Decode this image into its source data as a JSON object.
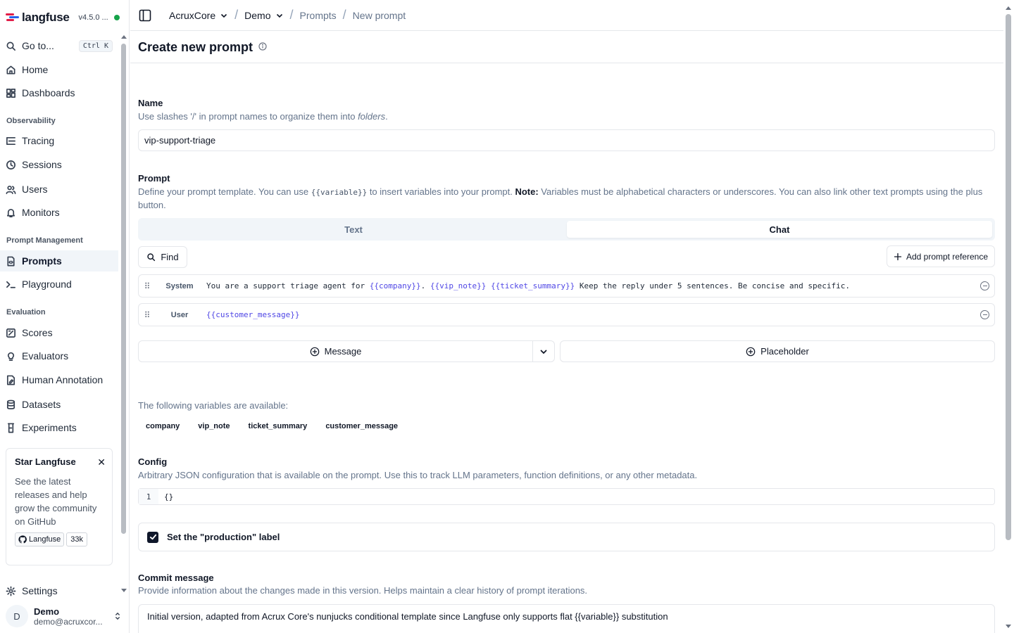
{
  "app": {
    "brand_name": "langfuse",
    "version": "v4.5.0 ...",
    "colors": {
      "accent": "#0f172a",
      "status_ok": "#16a34a",
      "variable": "#4f46e5",
      "muted": "#64748b"
    }
  },
  "sidebar": {
    "goto": {
      "label": "Go to...",
      "shortcut": "Ctrl K"
    },
    "top_items": [
      {
        "label": "Home",
        "icon": "home-icon"
      },
      {
        "label": "Dashboards",
        "icon": "dashboard-icon"
      }
    ],
    "groups": [
      {
        "title": "Observability",
        "items": [
          {
            "label": "Tracing",
            "icon": "tracing-icon"
          },
          {
            "label": "Sessions",
            "icon": "clock-icon"
          },
          {
            "label": "Users",
            "icon": "users-icon"
          },
          {
            "label": "Monitors",
            "icon": "bell-icon"
          }
        ]
      },
      {
        "title": "Prompt Management",
        "items": [
          {
            "label": "Prompts",
            "icon": "file-code-icon",
            "active": true
          },
          {
            "label": "Playground",
            "icon": "terminal-icon"
          }
        ]
      },
      {
        "title": "Evaluation",
        "items": [
          {
            "label": "Scores",
            "icon": "score-icon"
          },
          {
            "label": "Evaluators",
            "icon": "lightbulb-icon"
          },
          {
            "label": "Human Annotation",
            "icon": "annotation-icon"
          },
          {
            "label": "Datasets",
            "icon": "database-icon"
          },
          {
            "label": "Experiments",
            "icon": "flask-icon"
          }
        ]
      }
    ],
    "star_card": {
      "title": "Star Langfuse",
      "text": "See the latest releases and help grow the community on GitHub",
      "github_label": "Langfuse",
      "github_count": "33k"
    },
    "settings": "Settings",
    "user": {
      "initial": "D",
      "name": "Demo",
      "email": "demo@acruxcor..."
    }
  },
  "topbar": {
    "org": "AcruxCore",
    "project": "Demo",
    "section": "Prompts",
    "page": "New prompt"
  },
  "page": {
    "title": "Create new prompt",
    "name": {
      "label": "Name",
      "desc_before": "Use slashes '/' in prompt names to organize them into ",
      "desc_em": "folders",
      "desc_after": ".",
      "value": "vip-support-triage"
    },
    "prompt": {
      "label": "Prompt",
      "desc_1": "Define your prompt template. You can use ",
      "desc_code": "{{variable}}",
      "desc_2": " to insert variables into your prompt. ",
      "desc_note": "Note:",
      "desc_3": " Variables must be alphabetical characters or underscores. You can also link other text prompts using the plus button.",
      "tabs": {
        "text": "Text",
        "chat": "Chat"
      },
      "find": "Find",
      "add_reference": "Add prompt reference",
      "messages": [
        {
          "role": "System",
          "parts": [
            [
              "You are a support triage agent for ",
              false
            ],
            [
              "{{company}}",
              true
            ],
            [
              ". ",
              false
            ],
            [
              "{{vip_note}}",
              true
            ],
            [
              " ",
              false
            ],
            [
              "{{ticket_summary}}",
              true
            ],
            [
              " Keep the reply under 5 sentences. Be concise and specific.",
              false
            ]
          ]
        },
        {
          "role": "User",
          "parts": [
            [
              "{{customer_message}}",
              true
            ]
          ]
        }
      ],
      "add_message": "Message",
      "add_placeholder": "Placeholder"
    },
    "variables": {
      "label": "The following variables are available:",
      "items": [
        "company",
        "vip_note",
        "ticket_summary",
        "customer_message"
      ]
    },
    "config": {
      "label": "Config",
      "desc": "Arbitrary JSON configuration that is available on the prompt. Use this to track LLM parameters, function definitions, or any other metadata.",
      "line_number": "1",
      "value": "{}"
    },
    "production_label": "Set the \"production\" label",
    "commit": {
      "label": "Commit message",
      "desc": "Provide information about the changes made in this version. Helps maintain a clear history of prompt iterations.",
      "value": "Initial version, adapted from Acrux Core's nunjucks conditional template since Langfuse only supports flat {{variable}} substitution"
    }
  }
}
